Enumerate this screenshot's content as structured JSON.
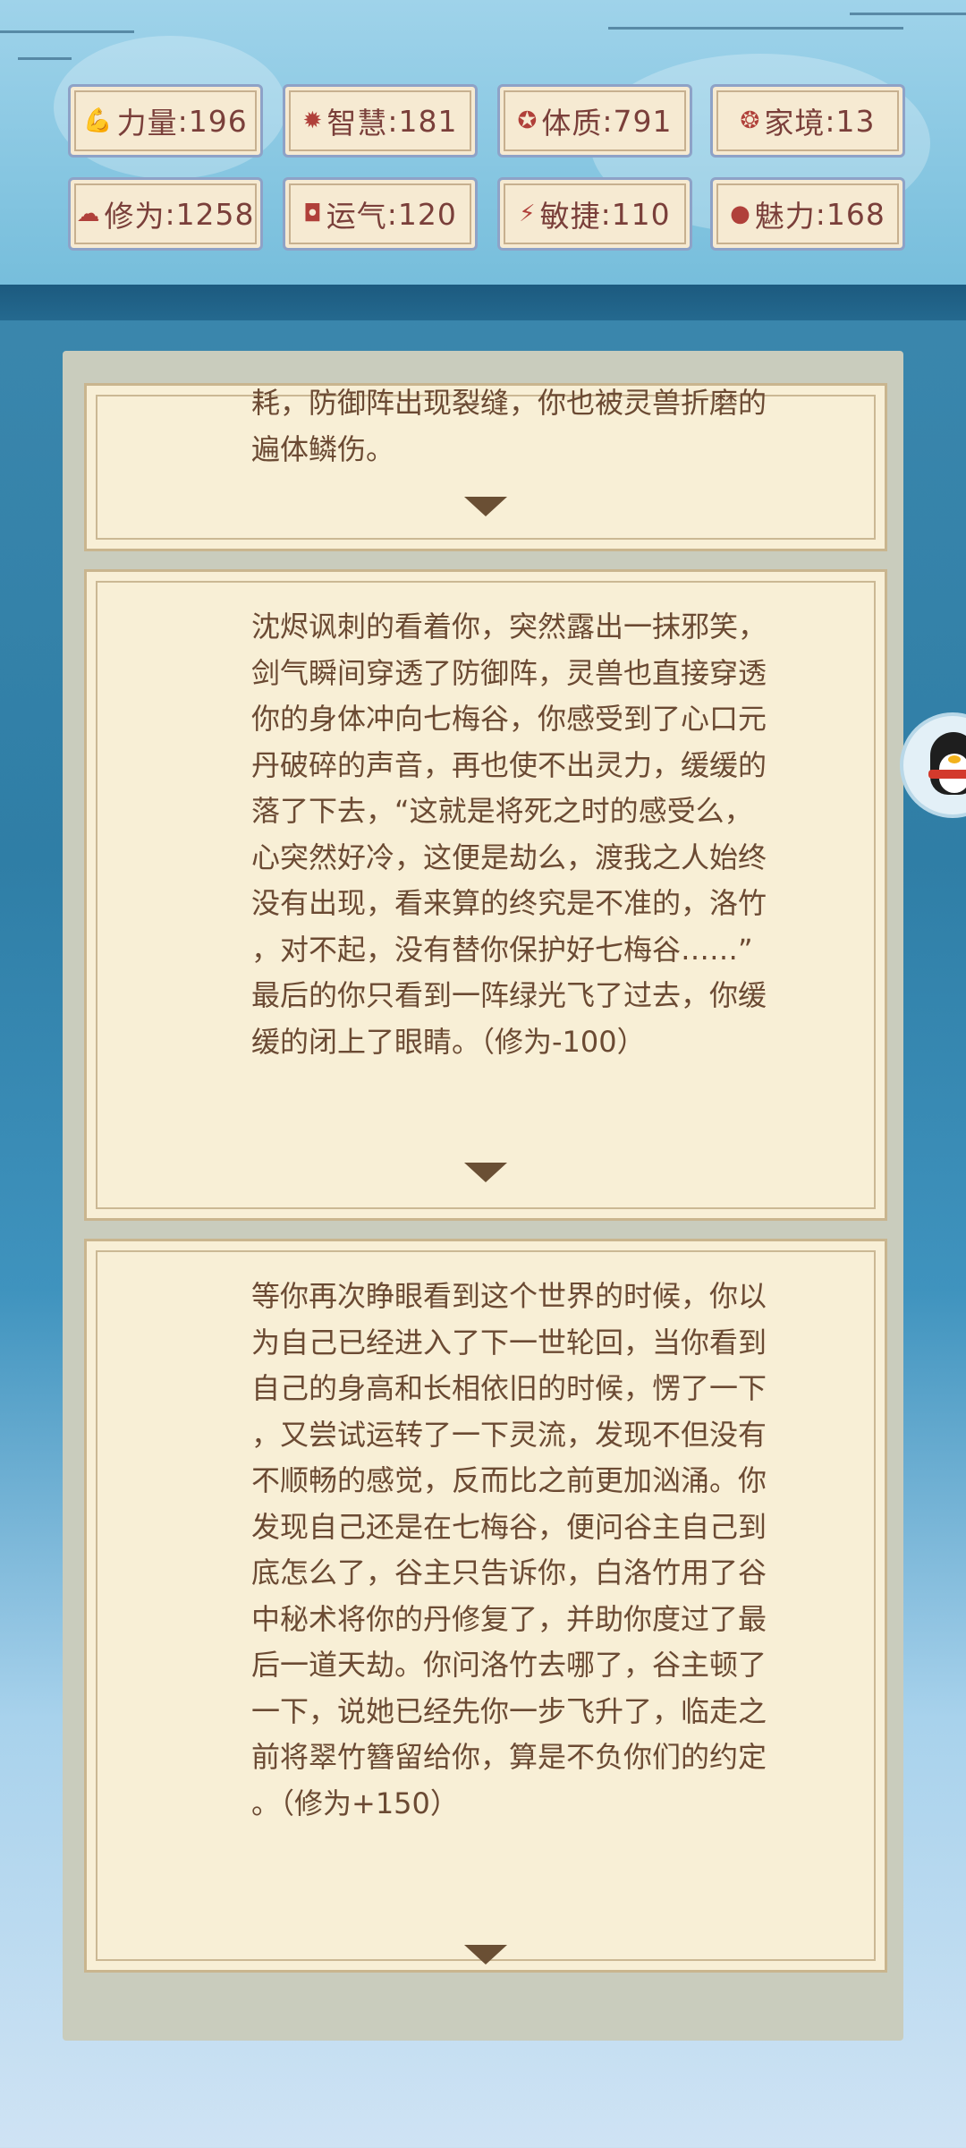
{
  "stats": [
    {
      "icon": "strength-icon",
      "glyph": "💪",
      "label": "力量",
      "value": "196"
    },
    {
      "icon": "wisdom-icon",
      "glyph": "✹",
      "label": "智慧",
      "value": "181"
    },
    {
      "icon": "constitution-icon",
      "glyph": "✪",
      "label": "体质",
      "value": "791"
    },
    {
      "icon": "family-icon",
      "glyph": "❂",
      "label": "家境",
      "value": "13"
    },
    {
      "icon": "cultivation-icon",
      "glyph": "☁",
      "label": "修为",
      "value": "1258"
    },
    {
      "icon": "luck-icon",
      "glyph": "◘",
      "label": "运气",
      "value": "120"
    },
    {
      "icon": "agility-icon",
      "glyph": "⚡",
      "label": "敏捷",
      "value": "110"
    },
    {
      "icon": "charm-icon",
      "glyph": "●",
      "label": "魅力",
      "value": "168"
    }
  ],
  "cards": [
    {
      "text": "耗，防御阵出现裂缝，你也被灵兽折磨的\n遍体鳞伤。"
    },
    {
      "text": "沈烬讽刺的看着你，突然露出一抹邪笑，\n剑气瞬间穿透了防御阵，灵兽也直接穿透\n你的身体冲向七梅谷，你感受到了心口元\n丹破碎的声音，再也使不出灵力，缓缓的\n落了下去，“这就是将死之时的感受么，\n心突然好冷，这便是劫么，渡我之人始终\n没有出现，看来算的终究是不准的，洛竹\n，对不起，没有替你保护好七梅谷……”\n最后的你只看到一阵绿光飞了过去，你缓\n缓的闭上了眼睛。（修为-100）"
    },
    {
      "text": "等你再次睁眼看到这个世界的时候，你以\n为自己已经进入了下一世轮回，当你看到\n自己的身高和长相依旧的时候，愣了一下\n，又尝试运转了一下灵流，发现不但没有\n不顺畅的感觉，反而比之前更加汹涌。你\n发现自己还是在七梅谷，便问谷主自己到\n底怎么了，谷主只告诉你，白洛竹用了谷\n中秘术将你的丹修复了，并助你度过了最\n后一道天劫。你问洛竹去哪了，谷主顿了\n一下，说她已经先你一步飞升了，临走之\n前将翠竹簪留给你，算是不负你们的约定\n。（修为+150）"
    }
  ]
}
